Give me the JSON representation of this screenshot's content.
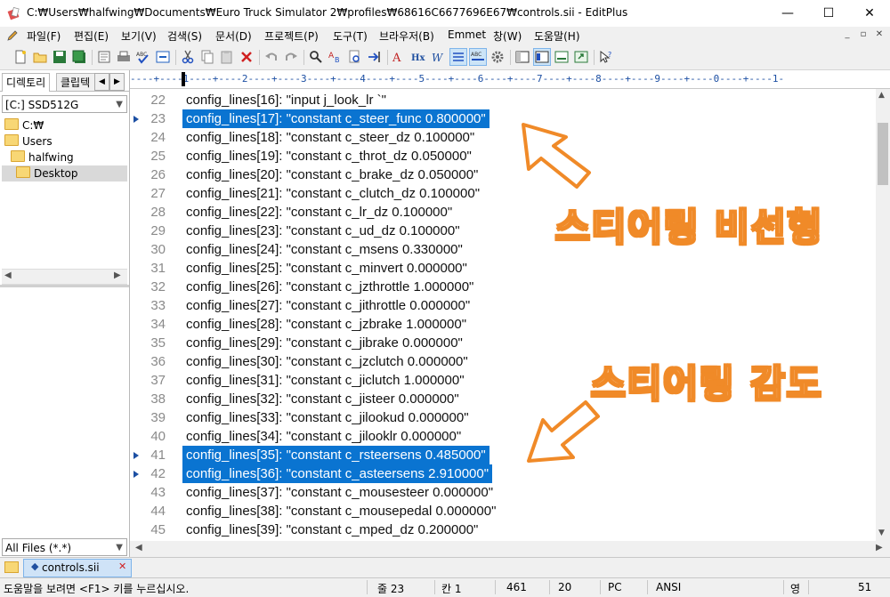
{
  "window": {
    "title": "C:₩Users₩halfwing₩Documents₩Euro Truck Simulator 2₩profiles₩68616C6677696E67₩controls.sii - EditPlus",
    "minimize": "—",
    "maximize": "☐",
    "close": "✕"
  },
  "menu": [
    "파일(F)",
    "편집(E)",
    "보기(V)",
    "검색(S)",
    "문서(D)",
    "프로젝트(P)",
    "도구(T)",
    "브라우저(B)",
    "Emmet",
    "창(W)",
    "도움말(H)"
  ],
  "mdi_buttons": [
    "_",
    "▫",
    "✕"
  ],
  "sidebar": {
    "tabs": [
      "디렉토리",
      "클립텍"
    ],
    "drive": "[C:] SSD512G",
    "tree": [
      {
        "label": "C:₩",
        "indent": 0
      },
      {
        "label": "Users",
        "indent": 1
      },
      {
        "label": "halfwing",
        "indent": 2
      },
      {
        "label": "Desktop",
        "indent": 3
      }
    ],
    "filter": "All Files (*.*)"
  },
  "ruler": "----+----1----+----2----+----3----+----4----+----5----+----6----+----7----+----8----+----9----+----0----+----1-",
  "editor": {
    "lines": [
      {
        "num": "22",
        "text": "config_lines[16]: \"input j_look_lr `\"",
        "selected": false
      },
      {
        "num": "23",
        "text": "config_lines[17]: \"constant c_steer_func 0.800000\"",
        "selected": true
      },
      {
        "num": "24",
        "text": "config_lines[18]: \"constant c_steer_dz 0.100000\"",
        "selected": false
      },
      {
        "num": "25",
        "text": "config_lines[19]: \"constant c_throt_dz 0.050000\"",
        "selected": false
      },
      {
        "num": "26",
        "text": "config_lines[20]: \"constant c_brake_dz 0.050000\"",
        "selected": false
      },
      {
        "num": "27",
        "text": "config_lines[21]: \"constant c_clutch_dz 0.100000\"",
        "selected": false
      },
      {
        "num": "28",
        "text": "config_lines[22]: \"constant c_lr_dz 0.100000\"",
        "selected": false
      },
      {
        "num": "29",
        "text": "config_lines[23]: \"constant c_ud_dz 0.100000\"",
        "selected": false
      },
      {
        "num": "30",
        "text": "config_lines[24]: \"constant c_msens 0.330000\"",
        "selected": false
      },
      {
        "num": "31",
        "text": "config_lines[25]: \"constant c_minvert 0.000000\"",
        "selected": false
      },
      {
        "num": "32",
        "text": "config_lines[26]: \"constant c_jzthrottle 1.000000\"",
        "selected": false
      },
      {
        "num": "33",
        "text": "config_lines[27]: \"constant c_jithrottle 0.000000\"",
        "selected": false
      },
      {
        "num": "34",
        "text": "config_lines[28]: \"constant c_jzbrake 1.000000\"",
        "selected": false
      },
      {
        "num": "35",
        "text": "config_lines[29]: \"constant c_jibrake 0.000000\"",
        "selected": false
      },
      {
        "num": "36",
        "text": "config_lines[30]: \"constant c_jzclutch 0.000000\"",
        "selected": false
      },
      {
        "num": "37",
        "text": "config_lines[31]: \"constant c_jiclutch 1.000000\"",
        "selected": false
      },
      {
        "num": "38",
        "text": "config_lines[32]: \"constant c_jisteer 0.000000\"",
        "selected": false
      },
      {
        "num": "39",
        "text": "config_lines[33]: \"constant c_jilookud 0.000000\"",
        "selected": false
      },
      {
        "num": "40",
        "text": "config_lines[34]: \"constant c_jilooklr 0.000000\"",
        "selected": false
      },
      {
        "num": "41",
        "text": "config_lines[35]: \"constant c_rsteersens 0.485000\"",
        "selected": true
      },
      {
        "num": "42",
        "text": "config_lines[36]: \"constant c_asteersens 2.910000\"",
        "selected": true
      },
      {
        "num": "43",
        "text": "config_lines[37]: \"constant c_mousesteer 0.000000\"",
        "selected": false
      },
      {
        "num": "44",
        "text": "config_lines[38]: \"constant c_mousepedal 0.000000\"",
        "selected": false
      },
      {
        "num": "45",
        "text": "config_lines[39]: \"constant c_mped_dz 0.200000\"",
        "selected": false
      }
    ]
  },
  "annotations": {
    "steering_nonlinear": "스티어링 비선형",
    "steering_sensitivity": "스티어링 감도"
  },
  "file_tab": "controls.sii",
  "status": {
    "hint": "도움말을 보려면 <F1> 키를 누르십시오.",
    "line": "줄 23",
    "col": "칸 1",
    "total": "461",
    "tab": "20",
    "os": "PC",
    "encoding": "ANSI",
    "extra": "영",
    "count": "51"
  },
  "colors": {
    "selection": "#0a74d1",
    "annotation": "#f08a28"
  }
}
